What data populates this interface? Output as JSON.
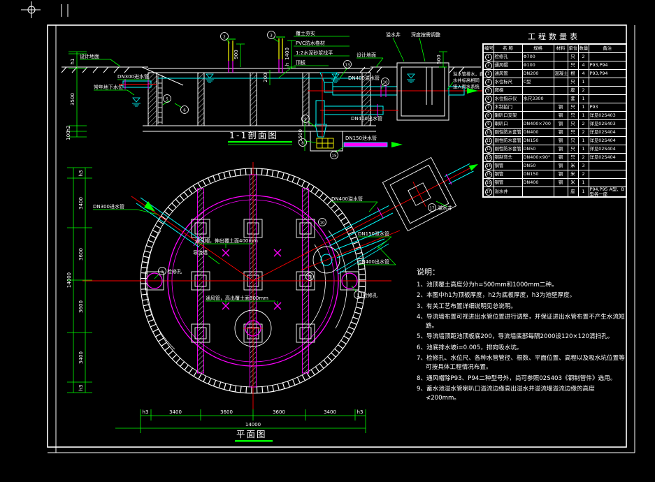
{
  "colors": {
    "green": "#00ff00",
    "cyan": "#00ffff",
    "magenta": "#ff00ff",
    "red": "#ff0000",
    "yellow": "#ffff00",
    "white": "#ffffff",
    "bg": "#000000"
  },
  "section": {
    "title": "1-1剖面图",
    "labels": {
      "design_ground_left": "设计地面",
      "dn300_inlet": "DN300进水管",
      "groundwater": "常年地下水位",
      "soil_compact": "覆土夯实",
      "pvc_layer": "PVC防水卷材",
      "mortar_layer": "1:2水泥砂浆找平",
      "top_slab": "顶板",
      "design_ground_right": "设计地面",
      "overflow_well": "溢水井",
      "depth_adjust": "深度按需调整",
      "well_note_1": "溢水管排水，自",
      "well_note_2": "水井标高相同",
      "well_note_3": "接入雨水系统",
      "dn400_overflow": "DN400溢水管",
      "dn400_outlet": "DN400出水管",
      "dn150_drain": "DN150泄水管"
    },
    "dims": {
      "h1": "h1",
      "d3500": "3500",
      "h2": "h2",
      "d100": "100",
      "d1400": "1400",
      "h": "h",
      "d900": "900",
      "d200": "200",
      "d500": "500",
      "d1500": "1500"
    }
  },
  "plan": {
    "title": "平面图",
    "labels": {
      "dn300_inlet": "DN300进水管",
      "manhole": "检修孔",
      "guide_wall": "导流墙",
      "vent_cap": "通风帽，伸出覆土面400mm",
      "vent_pipe": "通风管，高出覆土面900mm",
      "dn400_overflow": "DN400溢水管",
      "dn150_drain": "DN150泄水管",
      "dn400_outlet": "DN400出水管",
      "overflow_well": "溢水井"
    },
    "dims_left": [
      "h3",
      "3400",
      "3600",
      "3600",
      "3400",
      "h3"
    ],
    "dims_bottom": [
      "h3",
      "3400",
      "3600",
      "3600",
      "3400",
      "h3"
    ],
    "dim_total_left": "14000",
    "dim_total_bottom": "14000"
  },
  "callouts": {
    "c1": "1",
    "c2": "2",
    "c3": "3",
    "c5": "5",
    "c6": "6",
    "c8": "8",
    "c9": "9",
    "c10": "10",
    "c13": "13",
    "c15": "15",
    "c17": "17"
  },
  "table": {
    "title": "工程数量表",
    "headers": [
      "编号",
      "名  称",
      "规格",
      "材料",
      "单位",
      "数量",
      "备注"
    ],
    "rows": [
      [
        "1",
        "检修孔",
        "Φ700",
        "",
        "只",
        "2",
        ""
      ],
      [
        "2",
        "通风帽",
        "Φ100",
        "",
        "只",
        "4",
        "P93,P94"
      ],
      [
        "3",
        "通风管",
        "DN200",
        "混凝土",
        "根",
        "4",
        "P93,P94"
      ],
      [
        "4",
        "水位标尺",
        "C型",
        "",
        "只",
        "1",
        ""
      ],
      [
        "5",
        "爬梯",
        "",
        "",
        "座",
        "2",
        ""
      ],
      [
        "6",
        "水位指示仪",
        "水尺3300",
        "",
        "套",
        "1",
        ""
      ],
      [
        "7",
        "木制拍门",
        "",
        "钢",
        "只",
        "1",
        "P93"
      ],
      [
        "8",
        "喇叭口支架",
        "",
        "钢",
        "只",
        "1",
        "详见02S403"
      ],
      [
        "9",
        "喇叭口",
        "DN400×700",
        "钢",
        "只",
        "2",
        "详见02S403"
      ],
      [
        "10",
        "刚性防水套管",
        "DN400",
        "钢",
        "只",
        "2",
        "详见02S404"
      ],
      [
        "11",
        "刚性防水套管",
        "DN150",
        "钢",
        "只",
        "1",
        "详见02S404"
      ],
      [
        "12",
        "刚性防水套管",
        "DN50",
        "钢",
        "只",
        "1",
        "详见02S404"
      ],
      [
        "13",
        "钢制弯头",
        "DN400×90°",
        "钢",
        "只",
        "2",
        "详见02S404"
      ],
      [
        "14",
        "钢管",
        "DN50",
        "钢",
        "米",
        "3",
        ""
      ],
      [
        "15",
        "钢管",
        "DN150",
        "钢",
        "米",
        "2",
        ""
      ],
      [
        "16",
        "钢管",
        "DN400",
        "钢",
        "米",
        "1",
        ""
      ],
      [
        "17",
        "溢水井",
        "",
        "",
        "座",
        "1",
        "P94,P95 A型、B型各一座"
      ]
    ]
  },
  "notes": {
    "title": "说明：",
    "items": [
      "1、池顶覆土高度分为h=500mm和1000mm二种。",
      "2、本图中h1为顶板厚度，h2为底板厚度，h3为池壁厚度。",
      "3、有关工艺布置详细说明见总说明。",
      "4、导流墙布置可视进出水管位置进行调整，并保证进出水管布置不产生水流短路。",
      "5、导流墙顶距池顶板底200，导流墙底部每隔2000设120×120清扫孔。",
      "6、池底排水坡i=0.005，排向吸水坑。",
      "7、检修孔、水位尺、各种水管管径、根数、平面位置、高程以及吸水坑位置等可按具体工程情况布置。",
      "8、通风帽除P93、P94二种型号外，尚可参照02S403《钢制管件》选用。",
      "9、蓄水池溢水管喇叭口溢流边缘高出溢水井溢流堰溢流边缘的高度≮200mm。"
    ]
  }
}
